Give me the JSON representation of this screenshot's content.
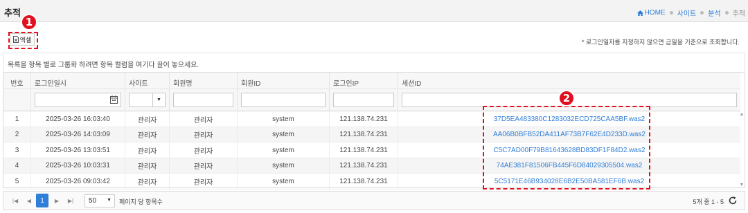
{
  "header": {
    "title": "추적",
    "breadcrumb": {
      "home": "HOME",
      "items": [
        "사이트",
        "분석",
        "추적"
      ]
    }
  },
  "toolbar": {
    "excel_label": "엑셀",
    "notice": "* 로그인일자를 지정하지 않으면 금일을 기준으로 조회합니다."
  },
  "grid": {
    "group_hint": "목록을 항목 별로 그룹화 하려면 항목 컬럼을 여기다 끌어 놓으세요.",
    "columns": [
      "번호",
      "로그인일시",
      "사이트",
      "회원명",
      "회원ID",
      "로그인IP",
      "세션ID"
    ],
    "rows": [
      {
        "no": "1",
        "login_time": "2025-03-26 16:03:40",
        "site": "관리자",
        "member_name": "관리자",
        "member_id": "system",
        "login_ip": "121.138.74.231",
        "session_id": "37D5EA483380C1283032ECD725CAA5BF.was2"
      },
      {
        "no": "2",
        "login_time": "2025-03-26 14:03:09",
        "site": "관리자",
        "member_name": "관리자",
        "member_id": "system",
        "login_ip": "121.138.74.231",
        "session_id": "AA06B0BFB52DA411AF73B7F62E4D233D.was2"
      },
      {
        "no": "3",
        "login_time": "2025-03-26 13:03:51",
        "site": "관리자",
        "member_name": "관리자",
        "member_id": "system",
        "login_ip": "121.138.74.231",
        "session_id": "C5C7AD00F79B81643628BD83DF1F84D2.was2"
      },
      {
        "no": "4",
        "login_time": "2025-03-26 10:03:31",
        "site": "관리자",
        "member_name": "관리자",
        "member_id": "system",
        "login_ip": "121.138.74.231",
        "session_id": "74AE381F81506FB445F6D84029305504.was2"
      },
      {
        "no": "5",
        "login_time": "2025-03-26 09:03:42",
        "site": "관리자",
        "member_name": "관리자",
        "member_id": "system",
        "login_ip": "121.138.74.231",
        "session_id": "5C5171E46B934028E6B2E50BA581EF6B.was2"
      }
    ]
  },
  "pager": {
    "current_page": "1",
    "page_size": "50",
    "page_size_label": "페이지 당 항목수",
    "info": "5개 중 1 - 5"
  },
  "annotations": {
    "marker1": "1",
    "marker2": "2"
  },
  "colors": {
    "accent": "#2f7ed8",
    "callout": "#e0101f"
  }
}
